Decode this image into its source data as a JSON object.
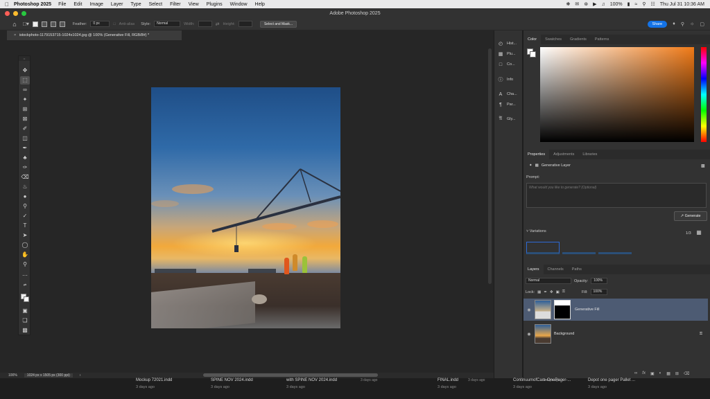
{
  "menubar": {
    "app_name": "Photoshop 2025",
    "items": [
      "File",
      "Edit",
      "Image",
      "Layer",
      "Type",
      "Select",
      "Filter",
      "View",
      "Plugins",
      "Window",
      "Help"
    ],
    "battery": "100%",
    "datetime": "Thu Jul 31  10:36 AM"
  },
  "window": {
    "title": "Adobe Photoshop 2025"
  },
  "options": {
    "feather_label": "Feather:",
    "feather_value": "0 px",
    "antialias_label": "Anti-alias",
    "style_label": "Style:",
    "style_value": "Normal",
    "width_label": "Width:",
    "height_label": "Height:",
    "select_mask_label": "Select and Mask...",
    "share_label": "Share"
  },
  "document": {
    "tab_title": "istockphoto-1179153715-1024x1024.jpg @ 100% (Generative Fill, RGB/8#) *",
    "zoom": "100%",
    "doc_info": "1024 px x 1505 px (300 ppi)"
  },
  "icon_strip": {
    "items": [
      {
        "icon": "history-icon",
        "label": "Hist..."
      },
      {
        "icon": "plugins-icon",
        "label": "Plu..."
      },
      {
        "icon": "comments-icon",
        "label": "Co..."
      },
      {
        "icon": "info-icon",
        "label": "Info"
      },
      {
        "icon": "character-icon",
        "label": "Cha..."
      },
      {
        "icon": "paragraph-icon",
        "label": "Par..."
      },
      {
        "icon": "glyphs-icon",
        "label": "Gly..."
      }
    ]
  },
  "color_panel": {
    "tabs": [
      "Color",
      "Swatches",
      "Gradients",
      "Patterns"
    ]
  },
  "properties_panel": {
    "tabs": [
      "Properties",
      "Adjustments",
      "Libraries"
    ],
    "layer_type": "Generative Layer",
    "prompt_label": "Prompt:",
    "prompt_placeholder": "What would you like to generate? (Optional)",
    "generate_label": "Generate",
    "variations_label": "Variations",
    "variations_count": "1/3"
  },
  "layers_panel": {
    "tabs": [
      "Layers",
      "Channels",
      "Paths"
    ],
    "blend_mode": "Normal",
    "opacity_label": "Opacity:",
    "opacity_value": "100%",
    "lock_label": "Lock:",
    "fill_label": "Fill:",
    "fill_value": "100%",
    "layers": [
      {
        "name": "Generative Fill",
        "selected": true
      },
      {
        "name": "Background",
        "selected": false
      }
    ]
  },
  "recent_files": [
    {
      "name": "Mockup 72021.indd",
      "date": "3 days ago"
    },
    {
      "name": "SPINE NOV 2024.indd",
      "date": "3 days ago"
    },
    {
      "name": "with SPINE NOV 2024.indd",
      "date": "3 days ago"
    },
    {
      "name": "FINAL.indd",
      "date": "3 days ago"
    },
    {
      "name": "ContinuumofCare-OnePager-...",
      "date": "3 days ago"
    },
    {
      "name": "Depot one pager Pallet ...",
      "date": "3 days ago"
    }
  ],
  "recent_files_dates_upper": [
    "3 days ago",
    "3 days ago",
    "3 days ago"
  ],
  "colors": {
    "accent": "#1473e6",
    "selected_layer": "#4d5b73",
    "panel_bg": "#323232"
  }
}
